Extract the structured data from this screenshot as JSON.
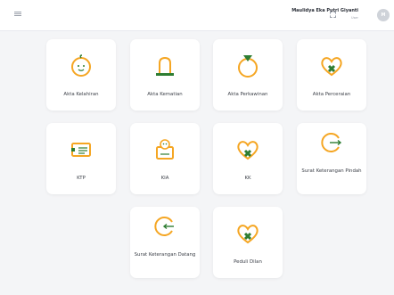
{
  "header": {
    "user_name": "Maulidya Eka Putri Giyanti",
    "user_role": "User",
    "avatar_initial": "M"
  },
  "services": [
    {
      "label": "Akta Kelahiran",
      "icon": "baby-face-icon"
    },
    {
      "label": "Akta Kematian",
      "icon": "tombstone-icon"
    },
    {
      "label": "Akta Perkawinan",
      "icon": "ring-icon"
    },
    {
      "label": "Akta Perceraian",
      "icon": "broken-heart-icon"
    },
    {
      "label": "KTP",
      "icon": "id-card-icon"
    },
    {
      "label": "KIA",
      "icon": "child-card-icon"
    },
    {
      "label": "KK",
      "icon": "family-heart-icon"
    },
    {
      "label": "Surat Keterangan Pindah",
      "icon": "move-out-icon"
    },
    {
      "label": "Surat Keterangan Datang",
      "icon": "move-in-icon"
    },
    {
      "label": "Peduli Dilan",
      "icon": "care-heart-icon"
    }
  ],
  "colors": {
    "accent_orange": "#f5a623",
    "accent_green": "#2e7d32"
  }
}
